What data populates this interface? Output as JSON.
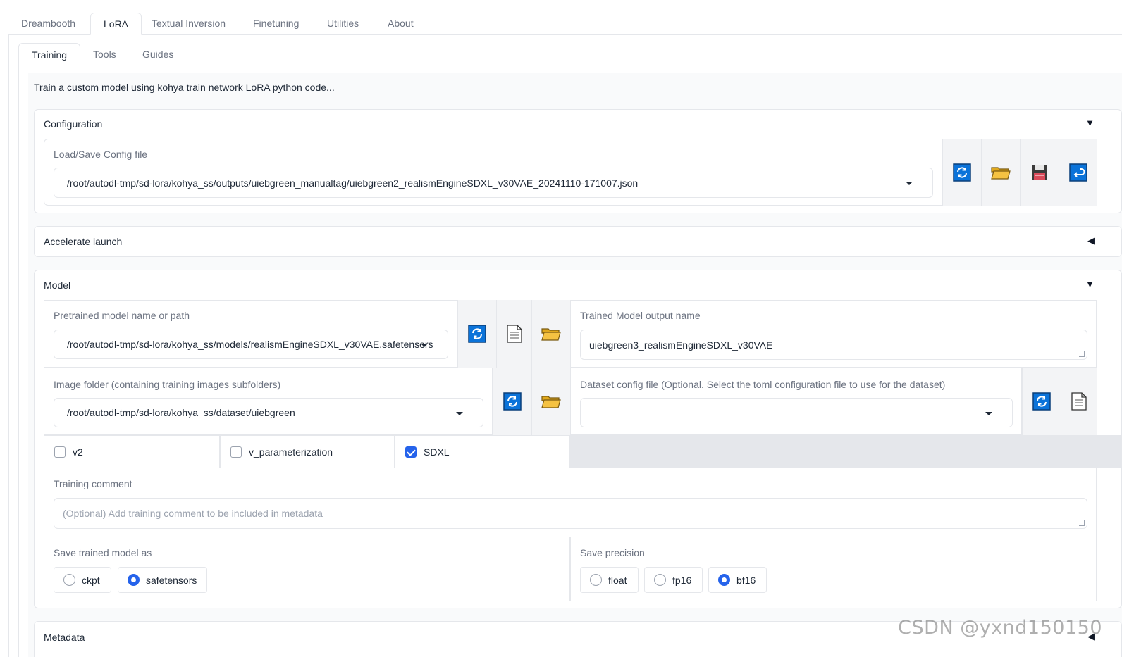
{
  "top_tabs": [
    {
      "label": "Dreambooth"
    },
    {
      "label": "LoRA"
    },
    {
      "label": "Textual Inversion"
    },
    {
      "label": "Finetuning"
    },
    {
      "label": "Utilities"
    },
    {
      "label": "About"
    }
  ],
  "active_top_tab": "LoRA",
  "sub_tabs": [
    {
      "label": "Training"
    },
    {
      "label": "Tools"
    },
    {
      "label": "Guides"
    }
  ],
  "active_sub_tab": "Training",
  "description": "Train a custom model using kohya train network LoRA python code...",
  "configuration": {
    "title": "Configuration",
    "expanded_arrow": "▼",
    "config_label": "Load/Save Config file",
    "config_value": "/root/autodl-tmp/sd-lora/kohya_ss/outputs/uiebgreen_manualtag/uiebgreen2_realismEngineSDXL_v30VAE_20241110-171007.json",
    "buttons": [
      "refresh-icon",
      "folder-icon",
      "save-icon",
      "return-icon"
    ]
  },
  "accelerate": {
    "title": "Accelerate launch",
    "collapsed_arrow": "◀"
  },
  "model": {
    "title": "Model",
    "expanded_arrow": "▼",
    "pretrained_label": "Pretrained model name or path",
    "pretrained_value": "/root/autodl-tmp/sd-lora/kohya_ss/models/realismEngineSDXL_v30VAE.safetensors",
    "output_name_label": "Trained Model output name",
    "output_name_value": "uiebgreen3_realismEngineSDXL_v30VAE",
    "image_folder_label": "Image folder (containing training images subfolders)",
    "image_folder_value": "/root/autodl-tmp/sd-lora/kohya_ss/dataset/uiebgreen",
    "dataset_config_label": "Dataset config file (Optional. Select the toml configuration file to use for the dataset)",
    "dataset_config_value": "",
    "checkboxes": [
      {
        "label": "v2",
        "checked": false
      },
      {
        "label": "v_parameterization",
        "checked": false
      },
      {
        "label": "SDXL",
        "checked": true
      }
    ],
    "training_comment_label": "Training comment",
    "training_comment_placeholder": "(Optional) Add training comment to be included in metadata",
    "save_as_label": "Save trained model as",
    "save_as_options": [
      {
        "label": "ckpt",
        "selected": false
      },
      {
        "label": "safetensors",
        "selected": true
      }
    ],
    "precision_label": "Save precision",
    "precision_options": [
      {
        "label": "float",
        "selected": false
      },
      {
        "label": "fp16",
        "selected": false
      },
      {
        "label": "bf16",
        "selected": true
      }
    ]
  },
  "metadata": {
    "title": "Metadata",
    "collapsed_arrow": "◀"
  },
  "watermark": "CSDN @yxnd150150",
  "colors": {
    "accent": "#2563eb",
    "icon_blue": "#0b73d9",
    "folder_yellow": "#f5c242",
    "border": "#e5e7eb"
  }
}
